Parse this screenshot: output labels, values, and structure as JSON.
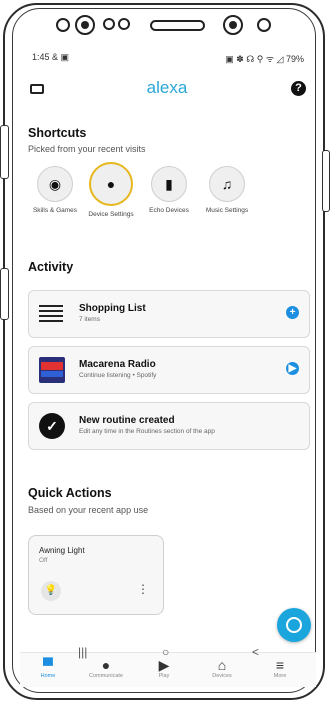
{
  "status_bar": {
    "time": "1:45",
    "left_icons": "& ▣",
    "right_icons": "▣ ✽ ☊ ⚲ ᯤ ◿",
    "battery": "79%"
  },
  "app_bar": {
    "logo": "alexa",
    "help": "?"
  },
  "shortcuts": {
    "title": "Shortcuts",
    "subtitle": "Picked from your recent visits",
    "items": [
      {
        "label": "Skills & Games",
        "icon": "location-pin-icon",
        "glyph": "◉"
      },
      {
        "label": "Device Settings",
        "icon": "device-icon",
        "glyph": "●"
      },
      {
        "label": "Echo Devices",
        "icon": "echo-device-icon",
        "glyph": "▮"
      },
      {
        "label": "Music Settings",
        "icon": "music-note-icon",
        "glyph": "♫"
      }
    ]
  },
  "activity": {
    "title": "Activity",
    "cards": [
      {
        "title": "Shopping List",
        "meta": "7 items",
        "action": "+"
      },
      {
        "title": "Macarena Radio",
        "meta": "Continue listening • Spotify",
        "action": "▶"
      },
      {
        "title": "New routine created",
        "meta": "Edit any time in the Routines section of the app",
        "action": ""
      }
    ]
  },
  "quick_actions": {
    "title": "Quick Actions",
    "subtitle": "Based on your recent app use",
    "card": {
      "title": "Awning Light",
      "state": "Off",
      "more": "⋮"
    }
  },
  "bottom_nav": [
    {
      "label": "Home",
      "glyph": "▀"
    },
    {
      "label": "Communicate",
      "glyph": "●"
    },
    {
      "label": "Play",
      "glyph": "▶"
    },
    {
      "label": "Devices",
      "glyph": "⌂"
    },
    {
      "label": "More",
      "glyph": "≡"
    }
  ],
  "system_nav": {
    "recent": "|||",
    "home": "○",
    "back": "<"
  },
  "colors": {
    "accent": "#1d8fe0",
    "logo": "#2aa7d8",
    "highlight_ring": "#e6b71e"
  }
}
